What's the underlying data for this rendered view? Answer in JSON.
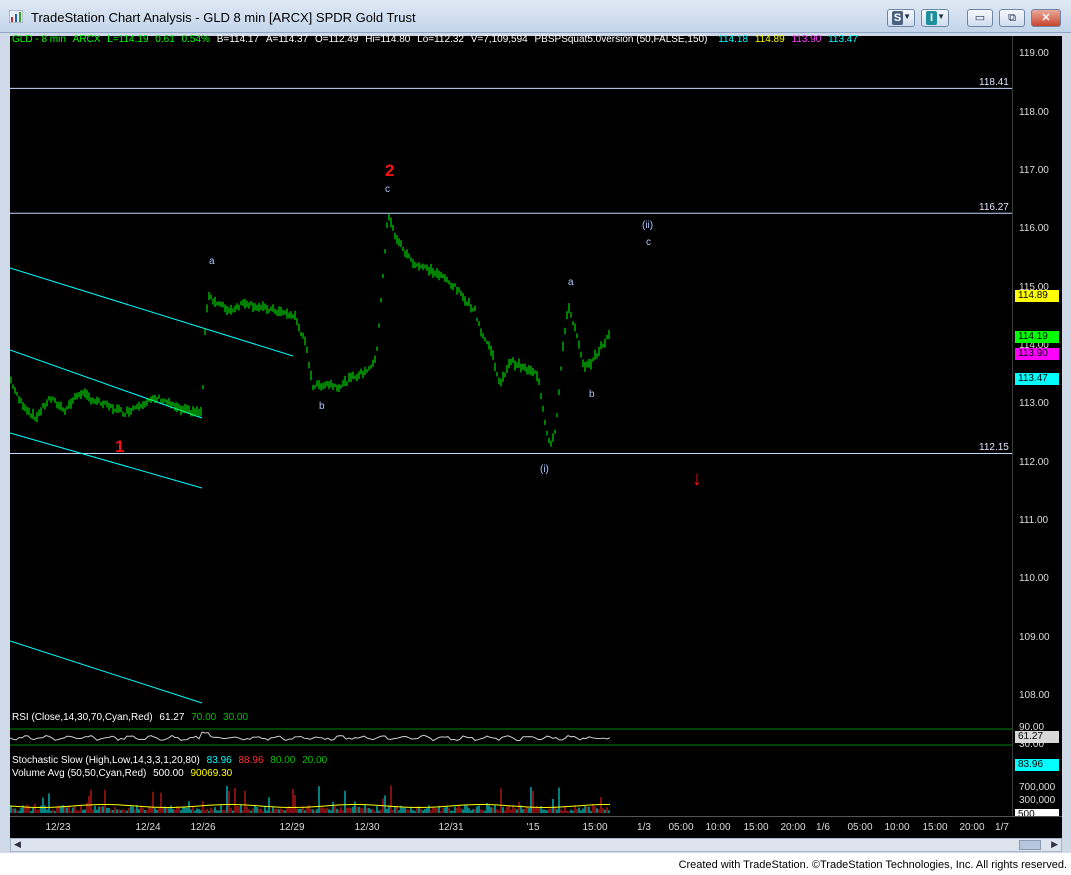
{
  "window": {
    "title": "TradeStation Chart Analysis - GLD 8 min [ARCX] SPDR Gold Trust",
    "s_button": "S",
    "i_button": "I",
    "minimize_glyph": "▭",
    "restore_glyph": "⧉",
    "close_glyph": "✕"
  },
  "chart": {
    "header": {
      "symbol": "GLD - 8 min",
      "exchange": "ARCX",
      "last": "L=114.19",
      "net_change": "0.61",
      "pct_change": "0.54%",
      "bid": "B=114.17",
      "ask": "A=114.37",
      "open": "O=112.49",
      "high": "Hi=114.80",
      "low": "Lo=112.32",
      "volume": "V=7,109,594",
      "indicator": "PBSPSquat5.0version (50,FALSE,150)",
      "indicator_values": [
        "114.18",
        "114.89",
        "113.90",
        "113.47"
      ]
    },
    "price_ticks": [
      "119.00",
      "118.00",
      "117.00",
      "116.00",
      "115.00",
      "114.00",
      "113.00",
      "112.00",
      "111.00",
      "110.00",
      "109.00",
      "108.00"
    ],
    "level_lines": [
      "118.41",
      "116.27",
      "112.15"
    ],
    "price_labels": [
      {
        "text": "114.89",
        "color": "#ffff00"
      },
      {
        "text": "114.19",
        "color": "#00ff00"
      },
      {
        "text": "113.90",
        "color": "#ff00ff"
      },
      {
        "text": "113.47",
        "color": "#00ffff"
      }
    ],
    "wave_labels": {
      "one": "1",
      "two": "2",
      "a1": "a",
      "b1": "b",
      "c1": "c",
      "i": "(i)",
      "ii": "(ii)",
      "ii_c": "c",
      "a2": "a",
      "b2": "b"
    },
    "down_arrow": "↓"
  },
  "rsi": {
    "label": "RSI (Close,14,30,70,Cyan,Red)",
    "value": "61.27",
    "overbought": "70.00",
    "oversold": "30.00",
    "scale_top": "90.00",
    "scale_label": "61.27",
    "scale_bottom": "30.00"
  },
  "lower_panel": {
    "stoch_label": "Stochastic Slow (High,Low,14,3,3,1,20,80)",
    "stoch_values": [
      "83.96",
      "88.96",
      "80.00",
      "20.00"
    ],
    "volume_label": "Volume Avg (50,50,Cyan,Red)",
    "volume_values": [
      "500.00",
      "90069.30"
    ],
    "scale": [
      "83.96",
      "700,000",
      "300,000",
      "500"
    ]
  },
  "time_axis": {
    "labels": [
      "12/23",
      "12/24",
      "12/26",
      "12/29",
      "12/30",
      "12/31",
      "'15",
      "15:00",
      "1/3",
      "05:00",
      "10:00",
      "15:00",
      "20:00",
      "1/6",
      "05:00",
      "10:00",
      "15:00",
      "20:00",
      "1/7"
    ]
  },
  "footer": {
    "text": "Created with TradeStation. ©TradeStation Technologies, Inc. All rights reserved."
  },
  "colors": {
    "price_bars": "#00ff00",
    "level_line": "#c0d8ff",
    "channel": "#00ffff",
    "wave_major": "#ff1010",
    "wave_minor": "#b0c8ff",
    "stoch_k": "#00ffff",
    "stoch_d": "#ff2020",
    "volume_avg": "#ffff00"
  }
}
